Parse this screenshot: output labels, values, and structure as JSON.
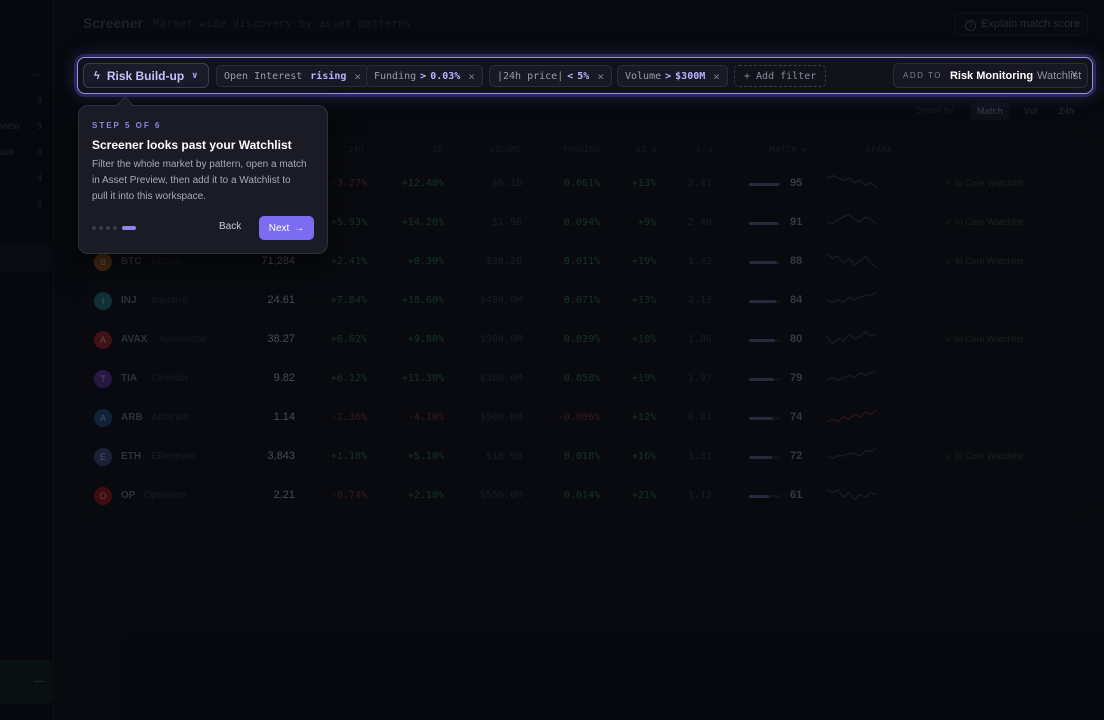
{
  "header": {
    "title": "Screener",
    "subtitle": "Market-wide discovery by asset patterns",
    "explain_label": "Explain match score"
  },
  "sidebar": {
    "items": [
      {
        "label": "",
        "count": "—"
      },
      {
        "label": "",
        "count": "8"
      },
      {
        "label": "view",
        "count": "9"
      },
      {
        "label": "um",
        "count": "3"
      },
      {
        "label": "",
        "count": "4"
      },
      {
        "label": "",
        "count": "6"
      }
    ],
    "bottom_label": "—"
  },
  "filter_bar": {
    "preset_label": "Risk Build-up",
    "chips": [
      {
        "field": "Open Interest",
        "op": "",
        "value": "rising"
      },
      {
        "field": "Funding",
        "op": ">",
        "value": "0.03%"
      },
      {
        "field": "|24h price|",
        "op": "<",
        "value": "5%"
      },
      {
        "field": "Volume",
        "op": ">",
        "value": "$300M"
      }
    ],
    "add_filter_label": "+ Add filter",
    "add_to": {
      "prefix": "ADD TO",
      "name": "Risk Monitoring",
      "kind": "Watchlist"
    }
  },
  "sort": {
    "label": "Sorted by",
    "options": [
      "Match",
      "Vol",
      "24h"
    ],
    "active": "Match"
  },
  "table": {
    "headers": [
      "24H",
      "7D",
      "VOLUME",
      "FUNDING",
      "OI Δ",
      "L/S",
      "MATCH ▾",
      "SPARK"
    ],
    "rows": [
      {
        "icon": "",
        "symbol": "",
        "name": "",
        "price": "",
        "d24": "-3.27%",
        "d7": "+12.40%",
        "volume": "$6.1B",
        "funding": "0.061%",
        "oi": "+13%",
        "ls": "2.41",
        "match": 95,
        "watchlist": "✓ In Core Watchlist",
        "color": "#2b2d3c",
        "spark": [
          5,
          6,
          5,
          4,
          5,
          3,
          4,
          2,
          3,
          1
        ]
      },
      {
        "icon": "",
        "symbol": "",
        "name": "",
        "price": "",
        "d24": "+5.93%",
        "d7": "+14.20%",
        "volume": "$1.9B",
        "funding": "0.094%",
        "oi": "+9%",
        "ls": "2.40",
        "match": 91,
        "watchlist": "✓ In Core Watchlist",
        "color": "#2b2d3c",
        "spark": [
          3,
          2,
          4,
          5,
          6,
          4,
          3,
          5,
          4,
          2
        ]
      },
      {
        "icon": "B",
        "symbol": "BTC",
        "name": "Bitcoin",
        "price": "71,284",
        "d24": "+2.41%",
        "d7": "+8.30%",
        "volume": "$38.2B",
        "funding": "0.011%",
        "oi": "+19%",
        "ls": "1.42",
        "match": 88,
        "watchlist": "✓ In Core Watchlist",
        "color": "#8a4b12",
        "spark": [
          6,
          4,
          5,
          2,
          4,
          1,
          3,
          5,
          2,
          0
        ]
      },
      {
        "icon": "I",
        "symbol": "INJ",
        "name": "Injective",
        "price": "24.61",
        "d24": "+7.84%",
        "d7": "+18.60%",
        "volume": "$480.0M",
        "funding": "0.071%",
        "oi": "+13%",
        "ls": "2.13",
        "match": 84,
        "watchlist": "",
        "color": "#1a5a63",
        "spark": [
          3,
          2,
          3,
          2,
          4,
          3,
          4,
          5,
          5,
          6
        ]
      },
      {
        "icon": "A",
        "symbol": "AVAX",
        "name": "Avalanche",
        "price": "38.27",
        "d24": "+6.62%",
        "d7": "+9.80%",
        "volume": "$900.0M",
        "funding": "0.039%",
        "oi": "+18%",
        "ls": "1.86",
        "match": 80,
        "watchlist": "✓ In Core Watchlist",
        "color": "#7a1e22",
        "spark": [
          4,
          1,
          3,
          2,
          5,
          3,
          4,
          6,
          4,
          5
        ]
      },
      {
        "icon": "T",
        "symbol": "TIA",
        "name": "Celestia",
        "price": "9.82",
        "d24": "+6.12%",
        "d7": "+11.30%",
        "volume": "$380.0M",
        "funding": "0.058%",
        "oi": "+19%",
        "ls": "1.97",
        "match": 79,
        "watchlist": "",
        "color": "#4a2a7a",
        "spark": [
          2,
          3,
          2,
          3,
          4,
          3,
          5,
          4,
          5,
          6
        ]
      },
      {
        "icon": "A",
        "symbol": "ARB",
        "name": "Arbitrum",
        "price": "1.14",
        "d24": "-2.36%",
        "d7": "-4.10%",
        "volume": "$500.0M",
        "funding": "-0.006%",
        "oi": "+12%",
        "ls": "0.81",
        "match": 74,
        "watchlist": "",
        "color": "#1e3f66",
        "spark": [
          1,
          2,
          1,
          3,
          2,
          4,
          3,
          5,
          4,
          6
        ]
      },
      {
        "icon": "E",
        "symbol": "ETH",
        "name": "Ethereum",
        "price": "3,843",
        "d24": "+1.18%",
        "d7": "+5.10%",
        "volume": "$18.9B",
        "funding": "0.018%",
        "oi": "+16%",
        "ls": "1.31",
        "match": 72,
        "watchlist": "✓ In Core Watchlist",
        "color": "#353a66",
        "spark": [
          3,
          2,
          3,
          3,
          4,
          4,
          3,
          5,
          5,
          6
        ]
      },
      {
        "icon": "O",
        "symbol": "OP",
        "name": "Optimism",
        "price": "2.21",
        "d24": "-0.74%",
        "d7": "+2.10%",
        "volume": "$550.0M",
        "funding": "0.014%",
        "oi": "+21%",
        "ls": "1.12",
        "match": 61,
        "watchlist": "",
        "color": "#7a1216",
        "spark": [
          5,
          4,
          5,
          2,
          4,
          1,
          3,
          2,
          4,
          3
        ]
      }
    ]
  },
  "tour": {
    "step_label": "STEP 5 OF 6",
    "title": "Screener looks past your Watchlist",
    "body": "Filter the whole market by pattern, open a match in Asset Preview, then add it to a Watchlist to pull it into this workspace.",
    "back_label": "Back",
    "next_label": "Next",
    "total_steps": 6,
    "current_step": 5
  },
  "colors": {
    "accent": "#7b6cf0",
    "accent_text": "#b9b2ff",
    "positive": "#265c46",
    "negative": "#6a2a30",
    "background": "#0b0c12"
  }
}
